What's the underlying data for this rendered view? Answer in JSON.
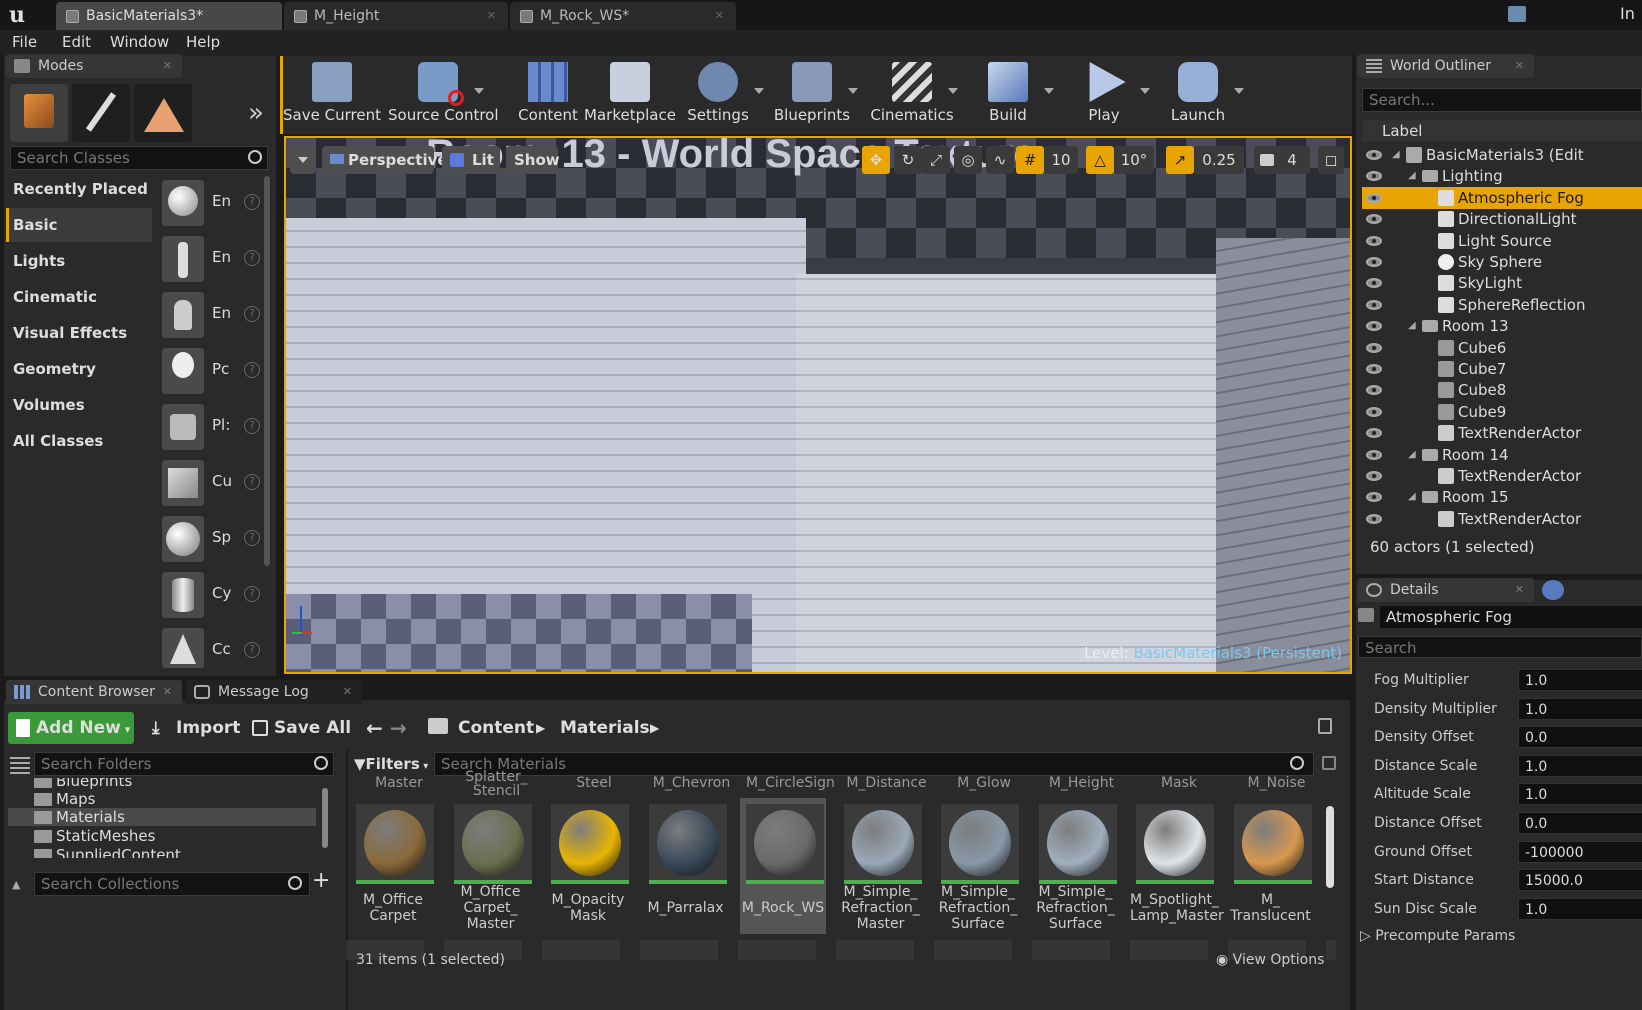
{
  "app": {
    "logo": "u"
  },
  "tabs": [
    {
      "label": "BasicMaterials3*"
    },
    {
      "label": "M_Height"
    },
    {
      "label": "M_Rock_WS*"
    }
  ],
  "titlebar_right": "In",
  "menu": [
    "File",
    "Edit",
    "Window",
    "Help"
  ],
  "modes": {
    "tab_label": "Modes",
    "search_placeholder": "Search Classes",
    "categories": [
      "Recently Placed",
      "Basic",
      "Lights",
      "Cinematic",
      "Visual Effects",
      "Geometry",
      "Volumes",
      "All Classes"
    ],
    "selected_category": "Basic",
    "actors": [
      "En",
      "En",
      "En",
      "Pc",
      "Pl:",
      "Cu",
      "Sp",
      "Cy",
      "Cc"
    ],
    "more": "»"
  },
  "toolbar": [
    {
      "label": "Save Current",
      "icon": "save-icon"
    },
    {
      "label": "Source Control",
      "icon": "source-control-icon"
    },
    {
      "label": "Content",
      "icon": "content-icon"
    },
    {
      "label": "Marketplace",
      "icon": "marketplace-icon"
    },
    {
      "label": "Settings",
      "icon": "settings-icon"
    },
    {
      "label": "Blueprints",
      "icon": "blueprints-icon"
    },
    {
      "label": "Cinematics",
      "icon": "cinematics-icon"
    },
    {
      "label": "Build",
      "icon": "build-icon"
    },
    {
      "label": "Play",
      "icon": "play-icon"
    },
    {
      "label": "Launch",
      "icon": "launch-icon"
    }
  ],
  "viewport": {
    "perspective": "Perspective",
    "lit": "Lit",
    "show": "Show",
    "grid_snap": "10",
    "rot_snap": "10°",
    "scale_snap": "0.25",
    "camera_speed": "4",
    "room_text": "Room. 13 - World Space Texture",
    "level_label": "Level:",
    "level_name": "BasicMaterials3 (Persistent)"
  },
  "outliner": {
    "tab_label": "World Outliner",
    "search_placeholder": "Search...",
    "column": "Label",
    "rows": [
      {
        "label": "BasicMaterials3 (Edit",
        "indent": 0,
        "icon": "world-icon",
        "expand": true
      },
      {
        "label": "Lighting",
        "indent": 1,
        "icon": "folder-icon",
        "expand": true
      },
      {
        "label": "Atmospheric Fog",
        "indent": 2,
        "icon": "fog-icon",
        "selected": true
      },
      {
        "label": "DirectionalLight",
        "indent": 2,
        "icon": "sun-icon"
      },
      {
        "label": "Light Source",
        "indent": 2,
        "icon": "sun-icon"
      },
      {
        "label": "Sky Sphere",
        "indent": 2,
        "icon": "sphere-icon"
      },
      {
        "label": "SkyLight",
        "indent": 2,
        "icon": "skylight-icon"
      },
      {
        "label": "SphereReflection",
        "indent": 2,
        "icon": "reflection-icon"
      },
      {
        "label": "Room 13",
        "indent": 1,
        "icon": "folder-icon",
        "expand": true
      },
      {
        "label": "Cube6",
        "indent": 2,
        "icon": "mesh-icon"
      },
      {
        "label": "Cube7",
        "indent": 2,
        "icon": "mesh-icon"
      },
      {
        "label": "Cube8",
        "indent": 2,
        "icon": "mesh-icon"
      },
      {
        "label": "Cube9",
        "indent": 2,
        "icon": "mesh-icon"
      },
      {
        "label": "TextRenderActor",
        "indent": 2,
        "icon": "text-icon"
      },
      {
        "label": "Room 14",
        "indent": 1,
        "icon": "folder-icon",
        "expand": true
      },
      {
        "label": "TextRenderActor",
        "indent": 2,
        "icon": "text-icon"
      },
      {
        "label": "Room 15",
        "indent": 1,
        "icon": "folder-icon",
        "expand": true
      },
      {
        "label": "TextRenderActor",
        "indent": 2,
        "icon": "text-icon"
      }
    ],
    "status": "60 actors (1 selected)"
  },
  "details": {
    "tab_label": "Details",
    "name": "Atmospheric Fog",
    "search_placeholder": "Search",
    "props": [
      {
        "label": "Fog Multiplier",
        "value": "1.0"
      },
      {
        "label": "Density Multiplier",
        "value": "1.0"
      },
      {
        "label": "Density Offset",
        "value": "0.0"
      },
      {
        "label": "Distance Scale",
        "value": "1.0"
      },
      {
        "label": "Altitude Scale",
        "value": "1.0"
      },
      {
        "label": "Distance Offset",
        "value": "0.0"
      },
      {
        "label": "Ground Offset",
        "value": "-100000"
      },
      {
        "label": "Start Distance",
        "value": "15000.0"
      },
      {
        "label": "Sun Disc Scale",
        "value": "1.0"
      }
    ],
    "precompute": "Precompute Params"
  },
  "content_browser": {
    "tab_label": "Content Browser",
    "tab2_label": "Message Log",
    "add_new": "Add New",
    "import": "Import",
    "save_all": "Save All",
    "path": [
      "Content",
      "Materials"
    ],
    "search_folders": "Search Folders",
    "folders": [
      "Blueprints",
      "Maps",
      "Materials",
      "StaticMeshes",
      "SuppliedContent"
    ],
    "selected_folder": "Materials",
    "search_collections": "Search Collections",
    "filters": "Filters",
    "search_assets": "Search Materials",
    "top_labels": [
      "Master",
      "Splatter_\nStencil",
      "Steel",
      "M_Chevron",
      "M_CircleSign",
      "M_Distance",
      "M_Glow",
      "M_Height",
      "Mask",
      "M_Noise"
    ],
    "assets": [
      {
        "label": "M_Office\nCarpet",
        "color": "#8a6a3a"
      },
      {
        "label": "M_Office\nCarpet_\nMaster",
        "color": "#6a7050"
      },
      {
        "label": "M_Opacity\nMask",
        "color": "#e8b400"
      },
      {
        "label": "M_Parralax",
        "color": "#3a4a5a"
      },
      {
        "label": "M_Rock_WS",
        "color": "#6a6a6a",
        "selected": true
      },
      {
        "label": "M_Simple_\nRefraction_\nMaster",
        "color": "#9aa8b8"
      },
      {
        "label": "M_Simple_\nRefraction_\nSurface",
        "color": "#8898a8"
      },
      {
        "label": "M_Simple_\nRefraction_\nSurface",
        "color": "#a0aebe"
      },
      {
        "label": "M_Spotlight_\nLamp_Master",
        "color": "#e0e4e8"
      },
      {
        "label": "M_\nTranslucent",
        "color": "#d89850"
      }
    ],
    "status": "31 items (1 selected)",
    "view_options": "View Options"
  },
  "colors": {
    "accent": "#e8a400",
    "green": "#4caf50",
    "panel": "#2a2a2a"
  }
}
